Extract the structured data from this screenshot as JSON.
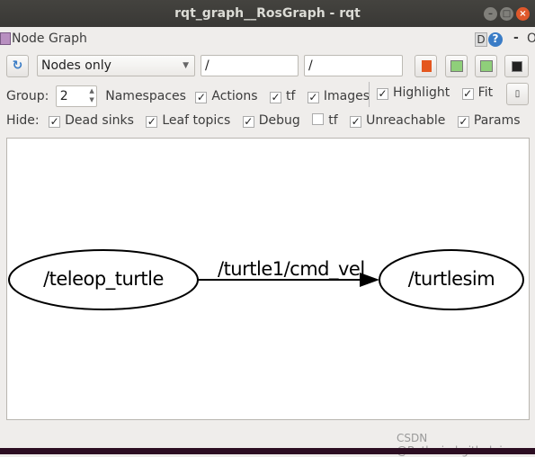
{
  "window": {
    "title": "rqt_graph__RosGraph - rqt",
    "controls": [
      "minimize",
      "maximize",
      "close"
    ]
  },
  "plugin": {
    "title": "Node Graph",
    "d_label": "D",
    "help": "?",
    "dash": "-",
    "o": "O"
  },
  "toolbar": {
    "refresh_icon": "refresh-icon",
    "mode": "Nodes only",
    "node_filter": "/",
    "topic_filter": "/"
  },
  "options": {
    "group_label": "Group:",
    "group_value": "2",
    "namespaces": "Namespaces",
    "checks": [
      {
        "label": "Actions",
        "checked": true
      },
      {
        "label": "tf",
        "checked": true
      },
      {
        "label": "Images",
        "checked": true
      }
    ],
    "right_checks": [
      {
        "label": "Highlight",
        "checked": true
      },
      {
        "label": "Fit",
        "checked": true
      }
    ]
  },
  "hide": {
    "label": "Hide:",
    "checks": [
      {
        "label": "Dead sinks",
        "checked": true
      },
      {
        "label": "Leaf topics",
        "checked": true
      },
      {
        "label": "Debug",
        "checked": true
      },
      {
        "label": "tf",
        "checked": false
      },
      {
        "label": "Unreachable",
        "checked": true
      },
      {
        "label": "Params",
        "checked": true
      }
    ]
  },
  "graph": {
    "nodes": [
      "/teleop_turtle",
      "/turtlesim"
    ],
    "edge_label": "/turtle1/cmd_vel"
  },
  "watermark": "CSDN @Bathwind.github.io"
}
